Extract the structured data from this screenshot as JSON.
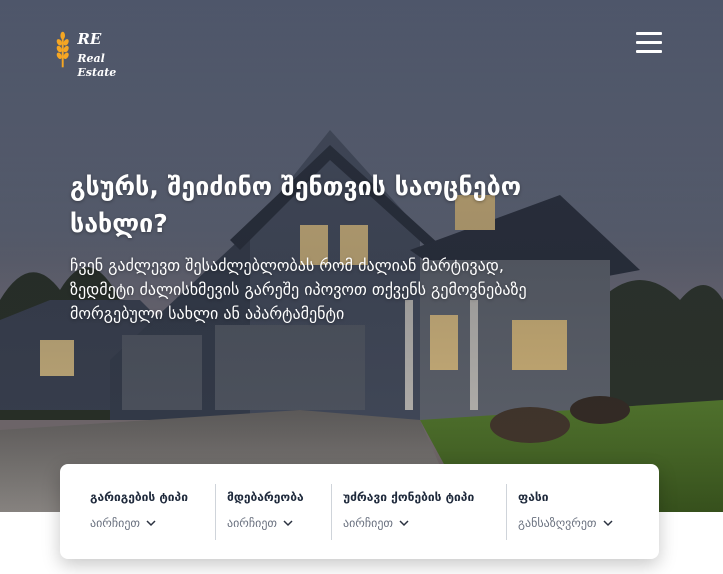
{
  "brand": {
    "abbr": "RE",
    "name": "Real Estate",
    "icon": "wheat-icon",
    "accent_color": "#f5a623"
  },
  "header": {
    "menu_icon": "hamburger-menu-icon"
  },
  "hero": {
    "title": "გსურს, შეიძინო შენთვის საოცნებო სახლი?",
    "description": "ჩვენ გაძლევთ შესაძლებლობას რომ ძალიან მარტივად, ზედმეტი ძალისხმევის გარეშე იპოვოთ თქვენს გემოვნებაზე მორგებული სახლი ან აპარტამენტი",
    "background": "house-at-dusk-photo"
  },
  "search": {
    "filters": [
      {
        "label": "გარიგების ტიპი",
        "value": "აირჩიეთ",
        "icon": "chevron-down-icon"
      },
      {
        "label": "მდებარეობა",
        "value": "აირჩიეთ",
        "icon": "chevron-down-icon"
      },
      {
        "label": "უძრავი ქონების ტიპი",
        "value": "აირჩიეთ",
        "icon": "chevron-down-icon"
      },
      {
        "label": "ფასი",
        "value": "განსაზღვრეთ",
        "icon": "chevron-down-icon"
      }
    ]
  }
}
